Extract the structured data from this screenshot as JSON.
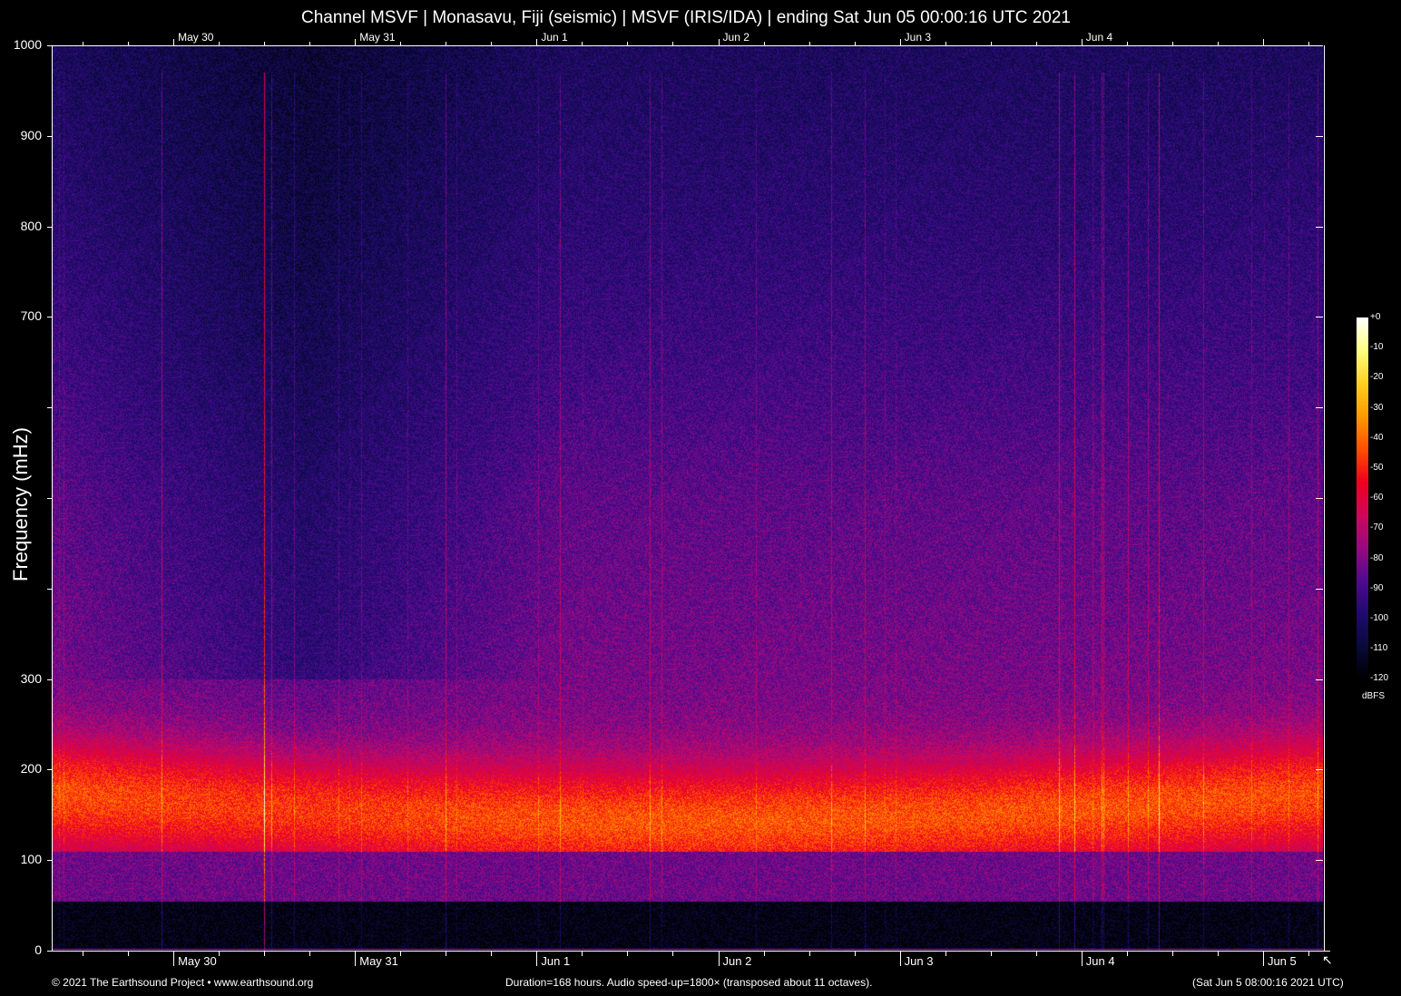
{
  "chart_data": {
    "type": "heatmap",
    "title": "Channel MSVF | Monasavu, Fiji (seismic) | MSVF (IRIS/IDA) | ending Sat Jun 05 00:00:16 UTC 2021",
    "ylabel": "Frequency (mHz)",
    "xlabel": "",
    "ylim": [
      0,
      1000
    ],
    "y_ticks": [
      0,
      100,
      200,
      300,
      400,
      500,
      600,
      700,
      800,
      900,
      1000
    ],
    "y_tick_labels": [
      "0",
      "100",
      "200",
      "300",
      "",
      "",
      "",
      "700",
      "800",
      "900",
      "1000"
    ],
    "x_range_days": [
      -0.67,
      6.33
    ],
    "x_top_labels": [
      "May 30",
      "May 31",
      "Jun  1",
      "Jun  2",
      "Jun  3",
      "Jun  4"
    ],
    "x_bottom_labels": [
      "May 30",
      "May 31",
      "Jun  1",
      "Jun  2",
      "Jun  3",
      "Jun  4",
      "Jun  5"
    ],
    "colorbar": {
      "label": "dBFS",
      "ticks": [
        "+0",
        "-10",
        "-20",
        "-30",
        "-40",
        "-50",
        "-60",
        "-70",
        "-80",
        "-90",
        "-100",
        "-110",
        "-120"
      ],
      "range": [
        -120,
        0
      ]
    },
    "colormap": [
      "#000000",
      "#0a0a3a",
      "#200a70",
      "#500a90",
      "#9a0a80",
      "#d0085a",
      "#f00020",
      "#ff5000",
      "#ff9a00",
      "#ffd020",
      "#ffff80",
      "#ffffff"
    ]
  },
  "footer": {
    "copyright": "© 2021 The Earthsound Project • www.earthsound.org",
    "info": "Duration=168 hours. Audio speed-up=1800× (transposed about 11 octaves).",
    "time": "(Sat Jun  5 08:00:16 2021 UTC)"
  }
}
